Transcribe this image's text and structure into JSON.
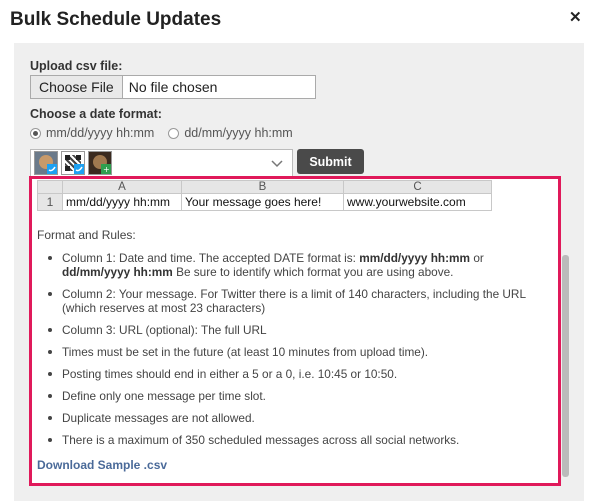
{
  "dialog": {
    "title": "Bulk Schedule Updates",
    "close_glyph": "✕"
  },
  "upload": {
    "label": "Upload csv file:",
    "button_label": "Choose File",
    "status": "No file chosen"
  },
  "date_format": {
    "label": "Choose a date format:",
    "options": [
      {
        "label": "mm/dd/yyyy hh:mm",
        "checked": true
      },
      {
        "label": "dd/mm/yyyy hh:mm",
        "checked": false
      }
    ]
  },
  "accounts": {
    "icons": [
      "profile-twitter-avatar-icon",
      "qr-code-avatar-icon",
      "profile-google-avatar-icon"
    ],
    "dropdown_icon": "chevron-down-icon"
  },
  "submit_label": "Submit",
  "sheet": {
    "columns": [
      "A",
      "B",
      "C"
    ],
    "row_number": "1",
    "cells": [
      "mm/dd/yyyy hh:mm",
      "Your message goes here!",
      "www.yourwebsite.com"
    ]
  },
  "rules": {
    "title": "Format and Rules:",
    "col1_text_a": "Column 1: Date and time. The accepted DATE format is: ",
    "col1_bold_a": "mm/dd/yyyy hh:mm",
    "col1_text_b": " or ",
    "col1_bold_b": "dd/mm/yyyy hh:mm",
    "col1_text_c": " Be sure to identify which format you are using above.",
    "items": [
      "Column 2: Your message. For Twitter there is a limit of 140 characters, including the URL (which reserves at most 23 characters)",
      "Column 3: URL (optional): The full URL",
      "Times must be set in the future (at least 10 minutes from upload time).",
      "Posting times should end in either a 5 or a 0, i.e. 10:45 or 10:50.",
      "Define only one message per time slot.",
      "Duplicate messages are not allowed.",
      "There is a maximum of 350 scheduled messages across all social networks."
    ]
  },
  "download_label": "Download Sample .csv",
  "colors": {
    "highlight_border": "#e0195a",
    "submit_bg": "#4a4a4a",
    "link": "#4a6a99"
  }
}
